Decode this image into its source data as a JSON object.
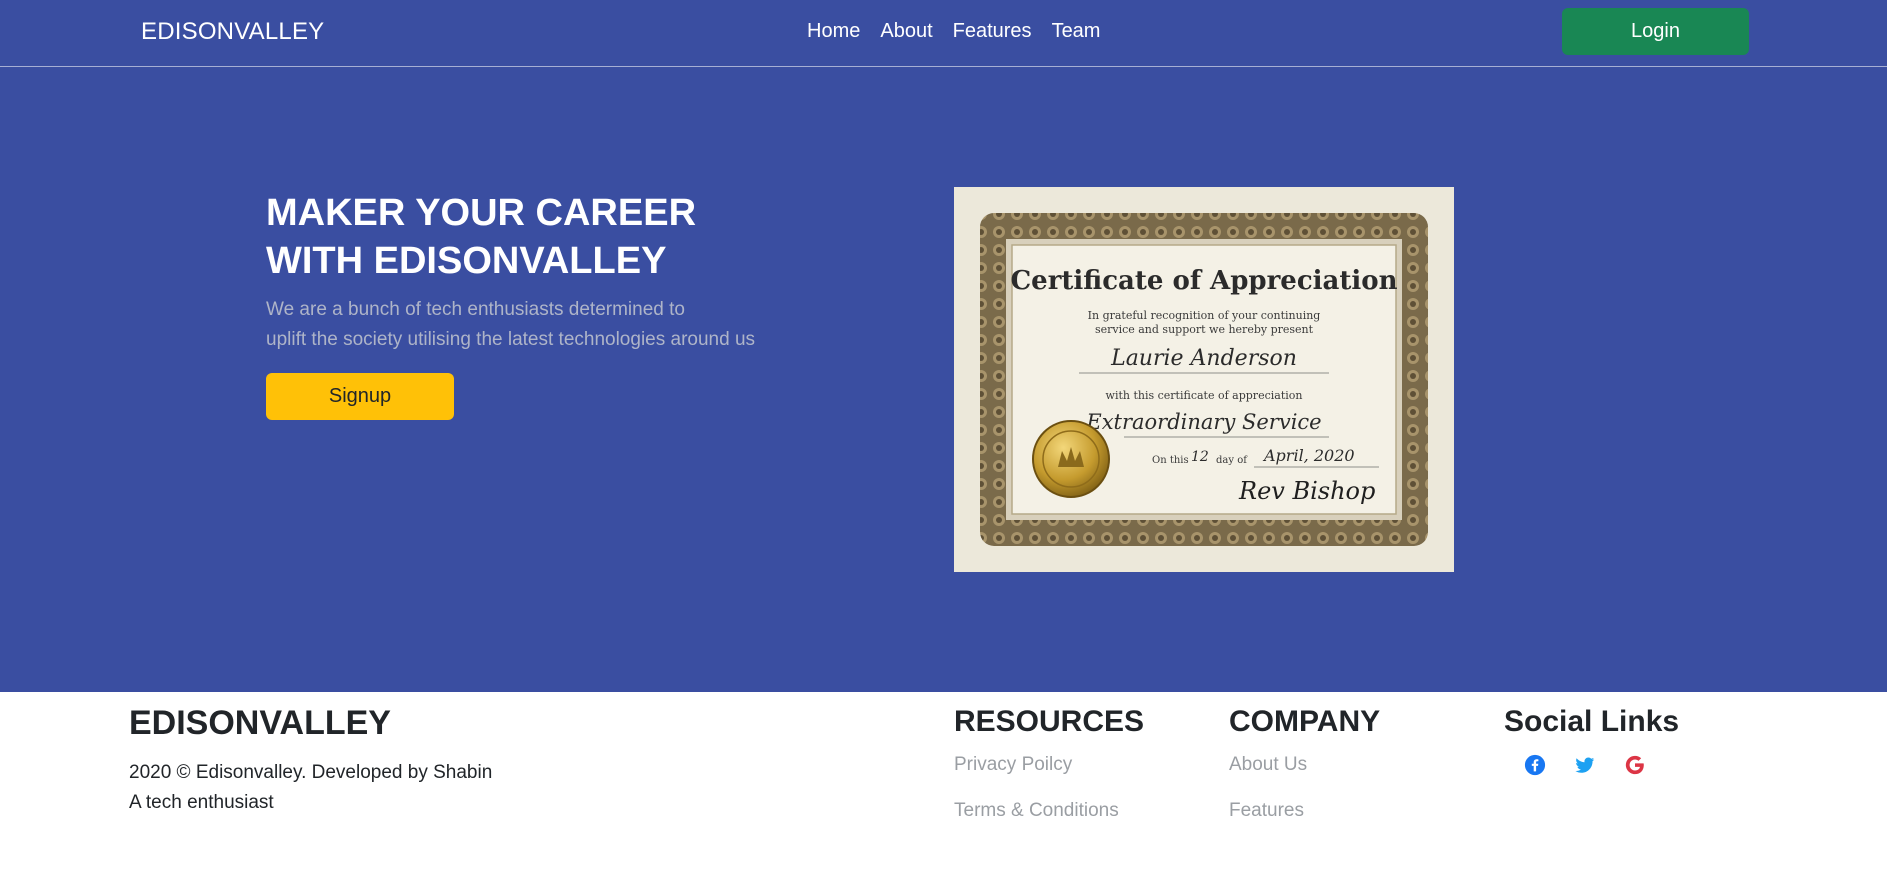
{
  "navbar": {
    "brand": "EDISONVALLEY",
    "links": [
      "Home",
      "About",
      "Features",
      "Team"
    ],
    "login_label": "Login"
  },
  "hero": {
    "title_lines": [
      "MAKER YOUR CAREER",
      "WITH EDISONVALLEY"
    ],
    "subtitle_lines": [
      "We are a bunch of tech enthusiasts determined to",
      "uplift the society utilising the latest technologies around us"
    ],
    "signup_label": "Signup",
    "certificate": {
      "heading": "Certificate of Appreciation",
      "line1": "In grateful recognition of your continuing",
      "line2": "service and support we hereby present",
      "recipient": "Laurie Anderson",
      "line3": "with this certificate of appreciation",
      "award": "Extraordinary Service",
      "on_this": "On this",
      "day": "12",
      "day_of": "day of",
      "date": "April, 2020",
      "signature": "Rev Bishop"
    }
  },
  "footer": {
    "brand": "EDISONVALLEY",
    "copy_lines": [
      "2020 © Edisonvalley. Developed by Shabin",
      "A tech enthusiast"
    ],
    "resources": {
      "title": "RESOURCES",
      "links": [
        "Privacy Poilcy",
        "Terms & Conditions"
      ]
    },
    "company": {
      "title": "COMPANY",
      "links": [
        "About Us",
        "Features"
      ]
    },
    "social": {
      "title": "Social Links",
      "icons": [
        "facebook-icon",
        "twitter-icon",
        "google-icon"
      ],
      "colors": {
        "facebook": "#1877f2",
        "twitter": "#1da1f2",
        "google": "#dc3545"
      }
    }
  },
  "colors": {
    "primary_bg": "#3a4ea1",
    "login_button": "#198754",
    "signup_button": "#ffc107",
    "subtitle_text": "#aeb4c8",
    "footer_link": "#9a9ea3"
  }
}
